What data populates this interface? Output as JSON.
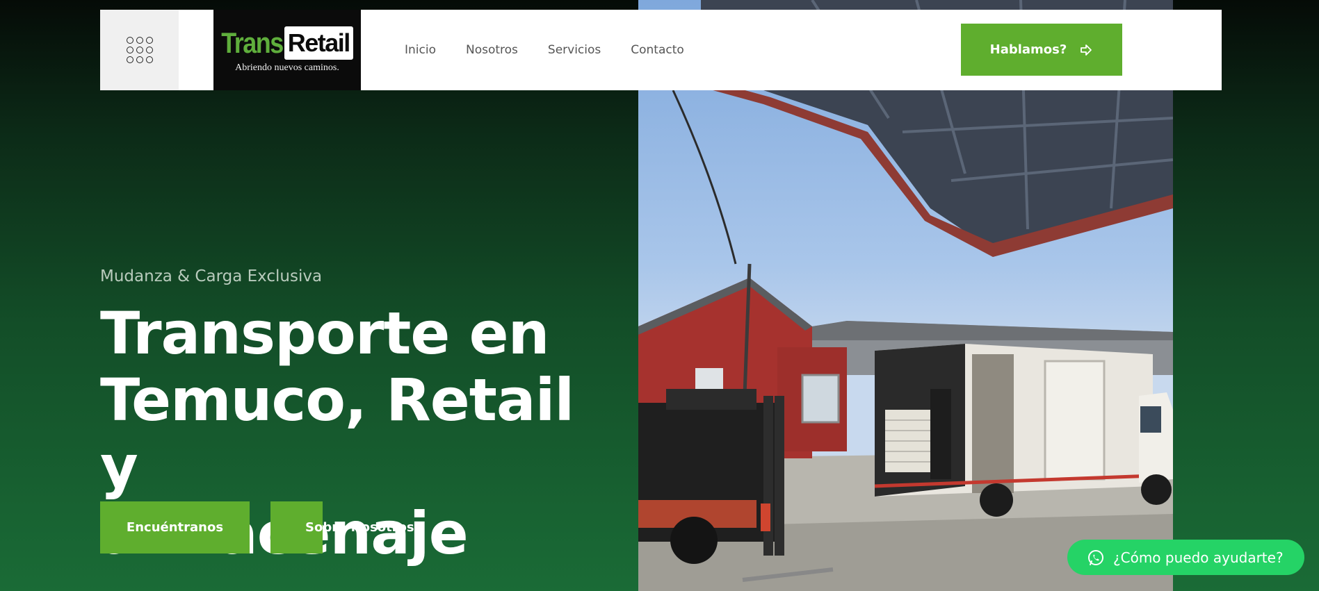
{
  "header": {
    "menu_icon": "grid-dots-icon",
    "logo": {
      "brand_part1": "Trans",
      "brand_part2": "Retail",
      "tagline": "Abriendo nuevos caminos."
    },
    "nav": [
      "Inicio",
      "Nosotros",
      "Servicios",
      "Contacto"
    ],
    "cta_label": "Hablamos?",
    "cta_icon": "arrow-right-icon"
  },
  "hero": {
    "eyebrow": "Mudanza & Carga Exclusiva",
    "headline_lines": [
      "Transporte en",
      "Temuco, Retail y",
      "almacenaje"
    ],
    "primary_button": "Encuéntranos",
    "secondary_button": "Sobre Nosotros",
    "image_alt_icon": "truck-loading-photo"
  },
  "whatsapp": {
    "label": "¿Cómo puedo ayudarte?",
    "icon": "whatsapp-icon"
  },
  "colors": {
    "accent": "#5fae2e",
    "whatsapp": "#25d366",
    "bg_top": "#050b07",
    "bg_bottom": "#1a6b36"
  }
}
